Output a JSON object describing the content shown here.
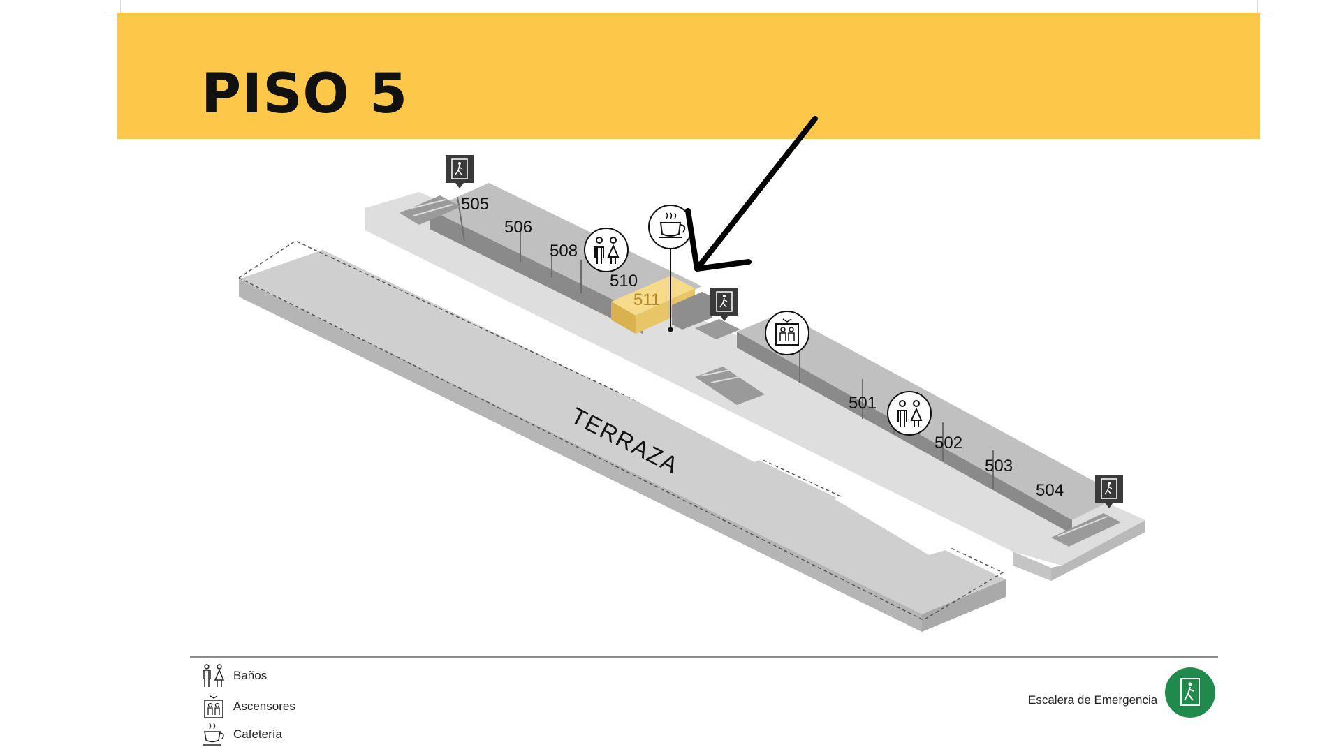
{
  "header": {
    "title": "PISO 5",
    "accent_color": "#fdc84a"
  },
  "map": {
    "rooms": [
      {
        "label": "505"
      },
      {
        "label": "506"
      },
      {
        "label": "508"
      },
      {
        "label": "510"
      },
      {
        "label": "511",
        "highlighted": true,
        "highlight_color": "#f2cd63"
      },
      {
        "label": "501"
      },
      {
        "label": "502"
      },
      {
        "label": "503"
      },
      {
        "label": "504"
      }
    ],
    "terrace_label": "TERRAZA",
    "icons": [
      "emergency-stair-marker-icon",
      "restroom-icon",
      "coffee-cup-icon",
      "elevator-icon",
      "arrow-pointer-icon"
    ]
  },
  "legend": {
    "items": [
      {
        "label": "Baños",
        "icon": "restroom-icon"
      },
      {
        "label": "Ascensores",
        "icon": "elevator-icon"
      },
      {
        "label": "Cafetería",
        "icon": "coffee-cup-icon"
      }
    ],
    "emergency": {
      "label": "Escalera de Emergencia",
      "icon": "emergency-stair-icon",
      "color": "#1f8a4c"
    }
  }
}
